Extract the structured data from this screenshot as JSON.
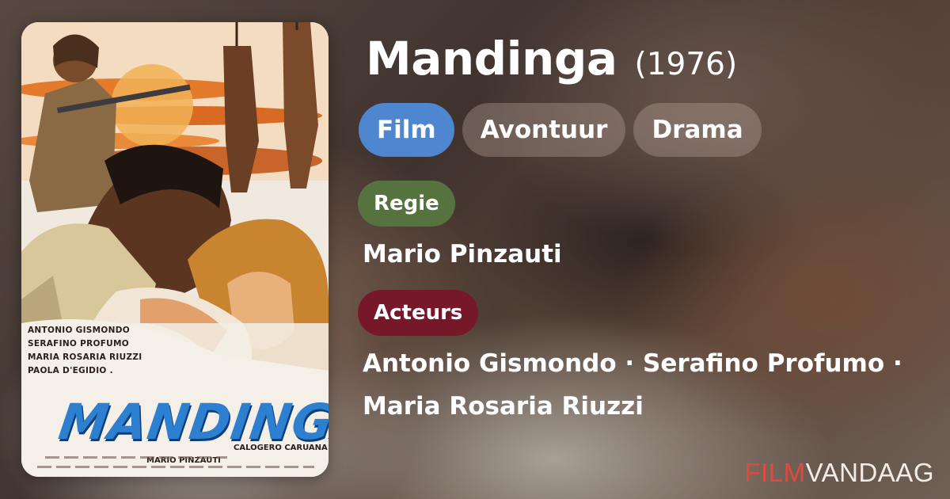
{
  "movie": {
    "title": "Mandinga",
    "year": "(1976)"
  },
  "genres": [
    "Film",
    "Avontuur",
    "Drama"
  ],
  "director_section": {
    "label": "Regie",
    "value": "Mario Pinzauti"
  },
  "cast_section": {
    "label": "Acteurs",
    "value": "Antonio Gismondo · Serafino Profumo · Maria Rosaria Riuzzi"
  },
  "poster": {
    "title": "MANDINGA",
    "cast": [
      "ANTONIO GISMONDO",
      "SERAFINO PROFUMO",
      "MARIA ROSARIA RIUZZI",
      "PAOLA D'EGIDIO ."
    ],
    "credit_producer": "CALOGERO CARUANA",
    "credit_director": "MARIO PINZAUTI"
  },
  "brand": {
    "part1": "FILM",
    "part2": "VANDAAG"
  },
  "colors": {
    "tag_primary": "#4f86d0",
    "regie_label": "#56733f",
    "acteurs_label": "#76182a",
    "brand_accent": "#e2493f"
  }
}
